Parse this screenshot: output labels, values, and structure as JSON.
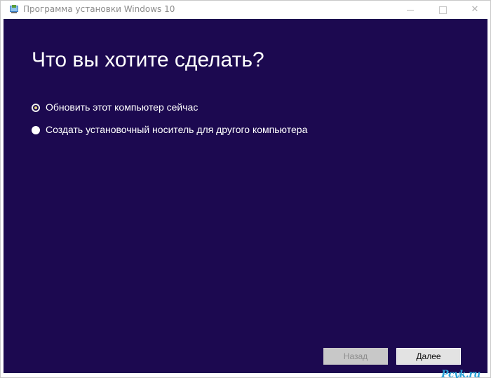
{
  "window": {
    "title": "Программа установки Windows 10",
    "controls": {
      "minimize": "",
      "maximize": "",
      "close": "✕"
    }
  },
  "page": {
    "heading": "Что вы хотите сделать?",
    "options": [
      {
        "label": "Обновить этот компьютер сейчас",
        "selected": true
      },
      {
        "label": "Создать установочный носитель для другого компьютера",
        "selected": false
      }
    ]
  },
  "footer": {
    "back_label": "Назад",
    "back_enabled": false,
    "next_label": "Далее"
  },
  "watermark": {
    "text": "Pcyk.ru"
  },
  "colors": {
    "background": "#1c0950",
    "heading": "#ffffff",
    "watermark": "#2aa3d8"
  }
}
